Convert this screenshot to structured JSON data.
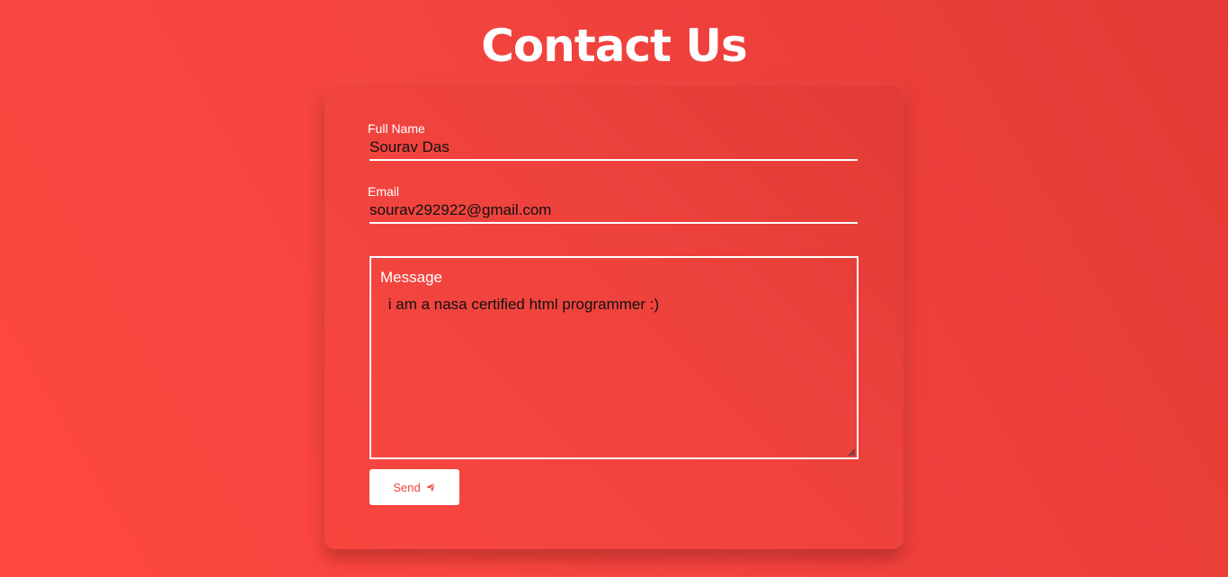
{
  "page": {
    "title": "Contact Us"
  },
  "form": {
    "full_name": {
      "label": "Full Name",
      "value": "Sourav Das"
    },
    "email": {
      "label": "Email",
      "value": "sourav292922@gmail.com"
    },
    "message": {
      "label": "Message",
      "value": " i am a nasa certified html programmer :)"
    },
    "send_button": {
      "label": "Send",
      "icon": "paper-plane-icon"
    }
  },
  "colors": {
    "background": "#f4443f",
    "card": "#ec403b",
    "text_light": "#ffffff",
    "button_text": "#f0433e"
  }
}
